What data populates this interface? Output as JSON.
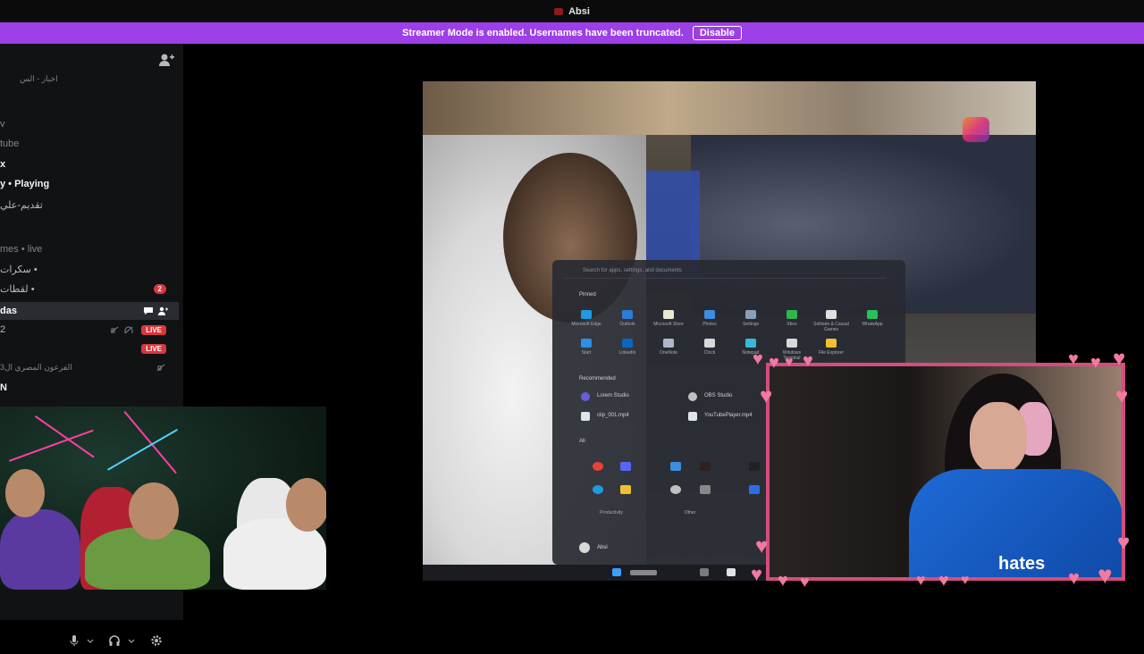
{
  "window": {
    "title": "Absi"
  },
  "banner": {
    "text": "Streamer Mode is enabled. Usernames have been truncated.",
    "button": "Disable"
  },
  "sidebar": {
    "rows": [
      {
        "text": "اخبار - الس",
        "style": "cat"
      },
      {
        "text": "v",
        "style": "cat"
      },
      {
        "text": "tube",
        "style": "cat"
      },
      {
        "text": "x",
        "style": "bold"
      },
      {
        "text": "y • Playing",
        "style": "bold"
      },
      {
        "text": "تقديم-علي",
        "style": "normal"
      },
      {
        "text": "mes • live",
        "style": "cat"
      },
      {
        "text": "سكرات •",
        "style": "normal"
      },
      {
        "text": "لقطات •",
        "style": "normal",
        "badge": "2"
      },
      {
        "text": "das",
        "style": "active"
      },
      {
        "text": "2",
        "style": "normal",
        "live": "LIVE"
      },
      {
        "text": "",
        "style": "normal",
        "live": "LIVE"
      },
      {
        "text": "الفرعون المصري ال3",
        "style": "cat"
      },
      {
        "text": "N",
        "style": "bold"
      }
    ]
  },
  "stream": {
    "start_menu": {
      "search_placeholder": "Search for apps, settings, and documents",
      "pinned_title": "Pinned",
      "recommended_title": "Recommended",
      "all_title": "All",
      "pinned_apps": [
        "Microsoft Edge",
        "Outlook",
        "Microsoft Store",
        "Photos",
        "Settings",
        "Xbox",
        "Solitaire & Casual Games",
        "WhatsApp",
        "Start",
        "LinkedIn",
        "OneNote",
        "Clock",
        "Notepad",
        "Windows Terminal",
        "File Explorer"
      ],
      "recommended": [
        "Lorem Studio",
        "OBS Studio",
        "clip_001.mp4",
        "YouTubePlayer.mp4"
      ],
      "groups": [
        "Productivity",
        "Other"
      ],
      "user": "Absi"
    },
    "overlay": {
      "jersey_text": "hates"
    }
  },
  "colors": {
    "banner": "#9d3fe7",
    "frame": "#d44d7e",
    "live": "#da373c",
    "sidebar": "#111214"
  },
  "icons": [
    "add-friend-icon",
    "mic-icon",
    "headset-icon",
    "settings-gear-icon",
    "chat-bubble-icon",
    "user-add-icon",
    "mute-icon"
  ]
}
